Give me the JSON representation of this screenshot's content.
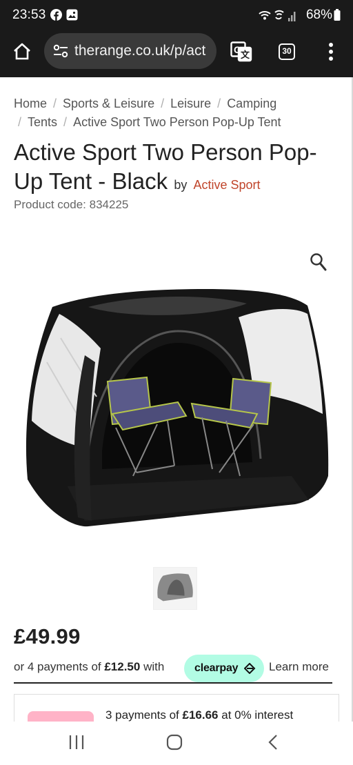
{
  "status": {
    "time": "23:53",
    "battery": "68%"
  },
  "browser": {
    "url": "therange.co.uk/p/act",
    "tab_count": "30"
  },
  "breadcrumb": [
    "Home",
    "Sports & Leisure",
    "Leisure",
    "Camping",
    "Tents",
    "Active Sport Two Person Pop-Up Tent"
  ],
  "product": {
    "title": "Active Sport Two Person Pop-Up Tent - Black",
    "by": "by",
    "brand": "Active Sport",
    "code": "Product code: 834225",
    "price": "£49.99",
    "clearpay": {
      "prefix": "or 4 payments of ",
      "amount": "£12.50",
      "suffix": " with",
      "badge": "clearpay",
      "learn_more": "Learn more"
    },
    "klarna": {
      "badge": "...",
      "prefix": "3 payments of ",
      "amount": "£16.66",
      "suffix": " at 0% interest"
    }
  },
  "colors": {
    "brand_link": "#c0452b",
    "clearpay_mint": "#b2fce4",
    "klarna_pink": "#ffb3c7",
    "system_bar": "#1a1a1a"
  },
  "icons": [
    "facebook-icon",
    "gallery-icon",
    "wifi-icon",
    "wifi-call-icon",
    "signal-icon",
    "battery-icon",
    "home-icon",
    "site-settings-icon",
    "translate-icon",
    "tabs-icon",
    "more-icon",
    "zoom-icon",
    "recents-icon",
    "home-nav-icon",
    "back-icon"
  ]
}
